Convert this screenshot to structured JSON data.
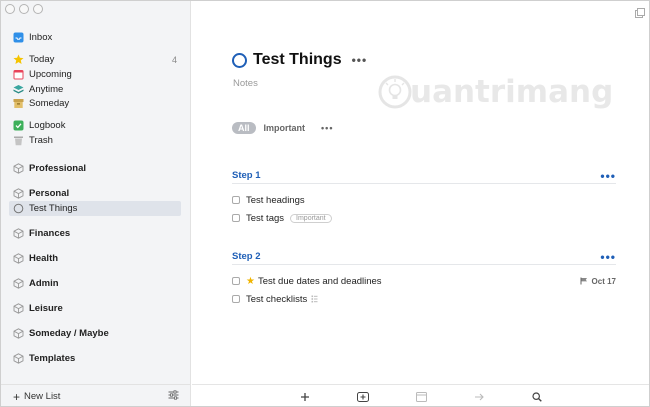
{
  "sidebar": {
    "items": [
      {
        "label": "Inbox",
        "count": ""
      },
      {
        "label": "Today",
        "count": "4"
      },
      {
        "label": "Upcoming",
        "count": ""
      },
      {
        "label": "Anytime",
        "count": ""
      },
      {
        "label": "Someday",
        "count": ""
      },
      {
        "label": "Logbook",
        "count": ""
      },
      {
        "label": "Trash",
        "count": ""
      },
      {
        "label": "Professional",
        "count": ""
      },
      {
        "label": "Personal",
        "count": ""
      },
      {
        "label": "Test Things",
        "count": ""
      },
      {
        "label": "Finances",
        "count": ""
      },
      {
        "label": "Health",
        "count": ""
      },
      {
        "label": "Admin",
        "count": ""
      },
      {
        "label": "Leisure",
        "count": ""
      },
      {
        "label": "Someday / Maybe",
        "count": ""
      },
      {
        "label": "Templates",
        "count": ""
      }
    ],
    "footer": {
      "new_list": "New List"
    }
  },
  "project": {
    "title": "Test Things",
    "notes_placeholder": "Notes",
    "tags": {
      "all": "All",
      "important": "Important"
    }
  },
  "headings": [
    {
      "label": "Step 1"
    },
    {
      "label": "Step 2"
    }
  ],
  "todos": [
    {
      "title": "Test headings"
    },
    {
      "title": "Test tags",
      "tag": "Important"
    },
    {
      "title": "Test due dates and deadlines",
      "deadline": "Oct 17"
    },
    {
      "title": "Test checklists"
    }
  ],
  "watermark": {
    "text": "uantrimang"
  },
  "colors": {
    "accent": "#1f5fb7",
    "selected": "#dfe3ea",
    "star": "#f0b400"
  }
}
